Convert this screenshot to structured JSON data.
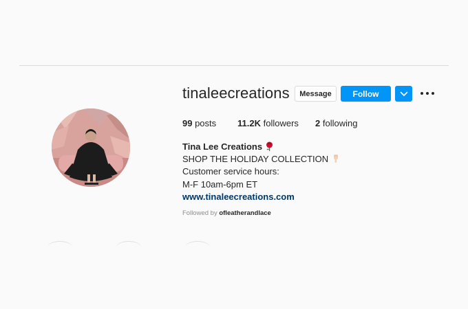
{
  "profile": {
    "username": "tinaleecreations",
    "avatar_description": "profile-photo"
  },
  "actions": {
    "message_label": "Message",
    "follow_label": "Follow",
    "dropdown_icon": "chevron-down-icon",
    "more_icon": "more-options-icon"
  },
  "stats": {
    "posts_count": "99",
    "posts_label": " posts",
    "followers_count": "11.2K",
    "followers_label": " followers",
    "following_count": "2",
    "following_label": " following"
  },
  "bio": {
    "name": "Tina Lee Creations",
    "name_emoji": "rose-icon",
    "line1": "SHOP THE HOLIDAY COLLECTION",
    "line1_emoji": "pointing-down-icon",
    "line2": "Customer service hours:",
    "line3": "M-F 10am-6pm ET",
    "link": "www.tinaleecreations.com"
  },
  "followed_by": {
    "prefix": "Followed by ",
    "account": "ofleatherandlace"
  },
  "colors": {
    "accent": "#0095f6",
    "link": "#00376b",
    "text": "#262626",
    "muted": "#8e8e8e",
    "background": "#fafafa"
  }
}
